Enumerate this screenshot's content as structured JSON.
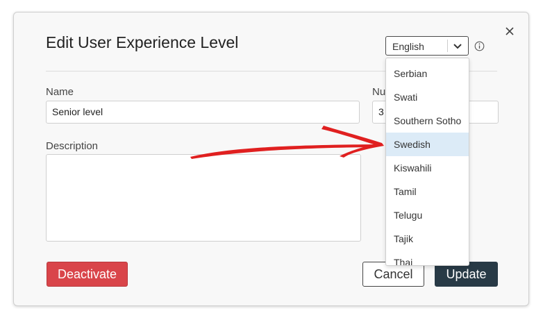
{
  "dialog": {
    "title": "Edit User Experience Level",
    "close_icon": "close-icon"
  },
  "language": {
    "selected": "English",
    "options": [
      "Serbian",
      "Swati",
      "Southern Sotho",
      "Swedish",
      "Kiswahili",
      "Tamil",
      "Telugu",
      "Tajik",
      "Thai"
    ],
    "highlighted_index": 3
  },
  "form": {
    "name_label": "Name",
    "name_value": "Senior level",
    "number_label": "Nu",
    "number_value": "3",
    "description_label": "Description",
    "description_value": ""
  },
  "buttons": {
    "deactivate": "Deactivate",
    "cancel": "Cancel",
    "update": "Update"
  },
  "colors": {
    "deactivate": "#d9454a",
    "update": "#283a46",
    "highlight": "#dcebf7",
    "annotation_arrow": "#e02020"
  }
}
